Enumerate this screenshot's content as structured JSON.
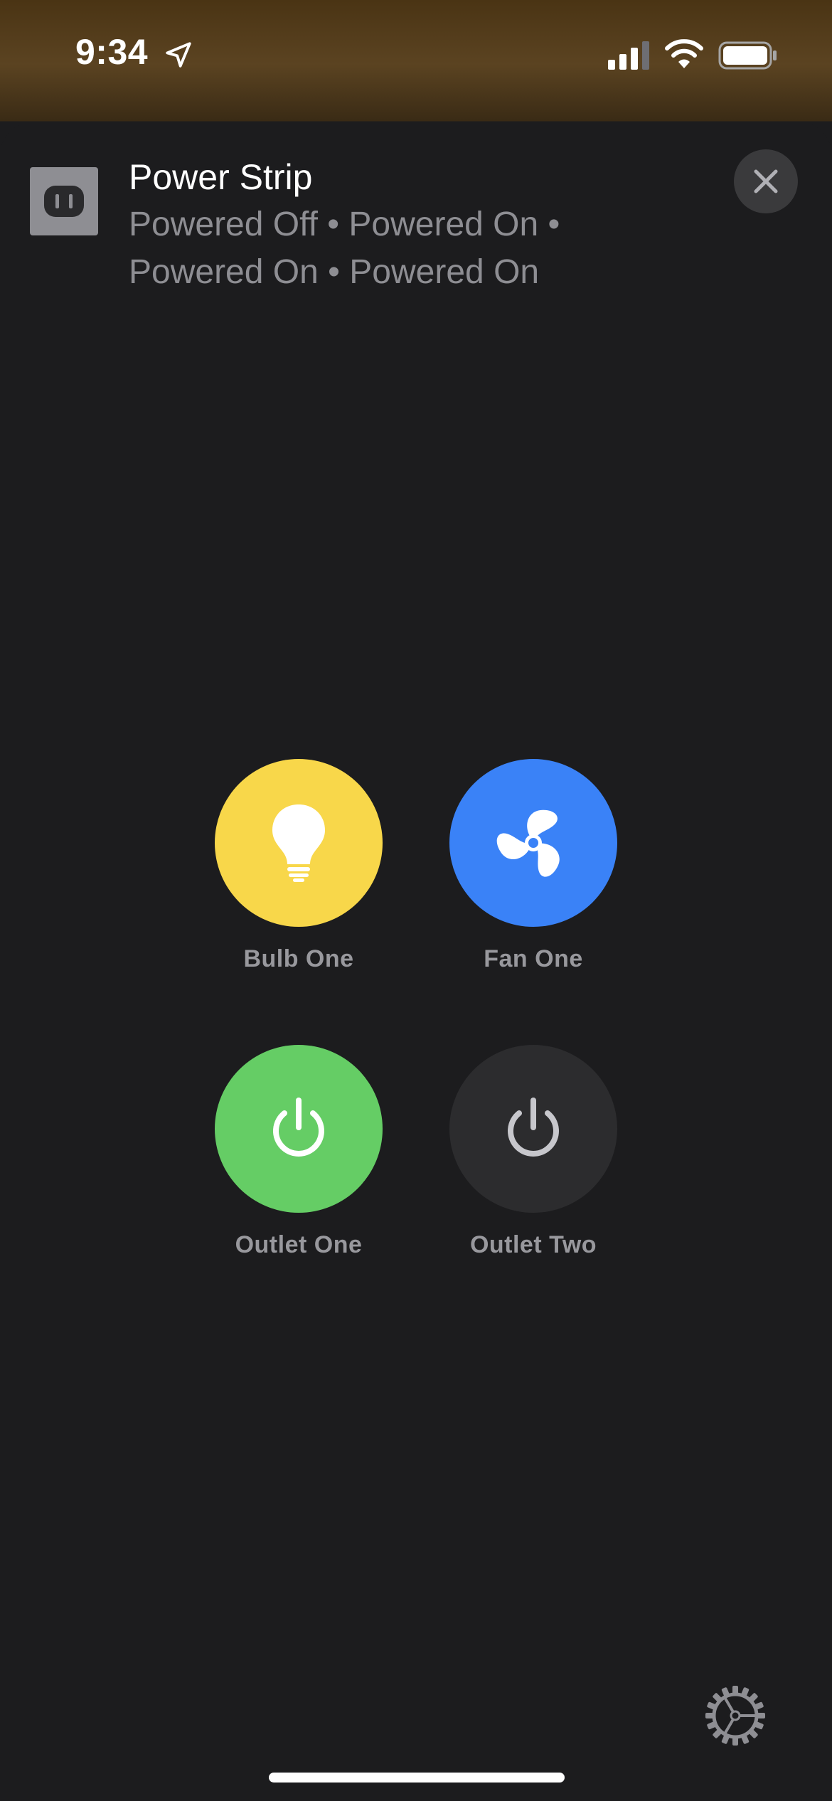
{
  "status_bar": {
    "time": "9:34",
    "icons": [
      "location-arrow-icon",
      "cellular-signal-icon",
      "wifi-icon",
      "battery-icon"
    ]
  },
  "header": {
    "device_icon": "power-outlet-icon",
    "title": "Power Strip",
    "subtitle": "Powered Off • Powered On • Powered On • Powered On",
    "close_icon": "close-icon"
  },
  "tiles": [
    {
      "label": "Bulb One",
      "icon": "lightbulb-icon",
      "state": "on",
      "color": "#F8D74A"
    },
    {
      "label": "Fan One",
      "icon": "fan-icon",
      "state": "on",
      "color": "#3A82F7"
    },
    {
      "label": "Outlet One",
      "icon": "power-icon",
      "state": "on",
      "color": "#65CD65"
    },
    {
      "label": "Outlet Two",
      "icon": "power-icon",
      "state": "off",
      "color": "#2C2C2E"
    }
  ],
  "footer": {
    "settings_icon": "gear-icon"
  },
  "colors": {
    "sheet_background": "#1C1C1E",
    "secondary_text": "#8E8E93"
  }
}
